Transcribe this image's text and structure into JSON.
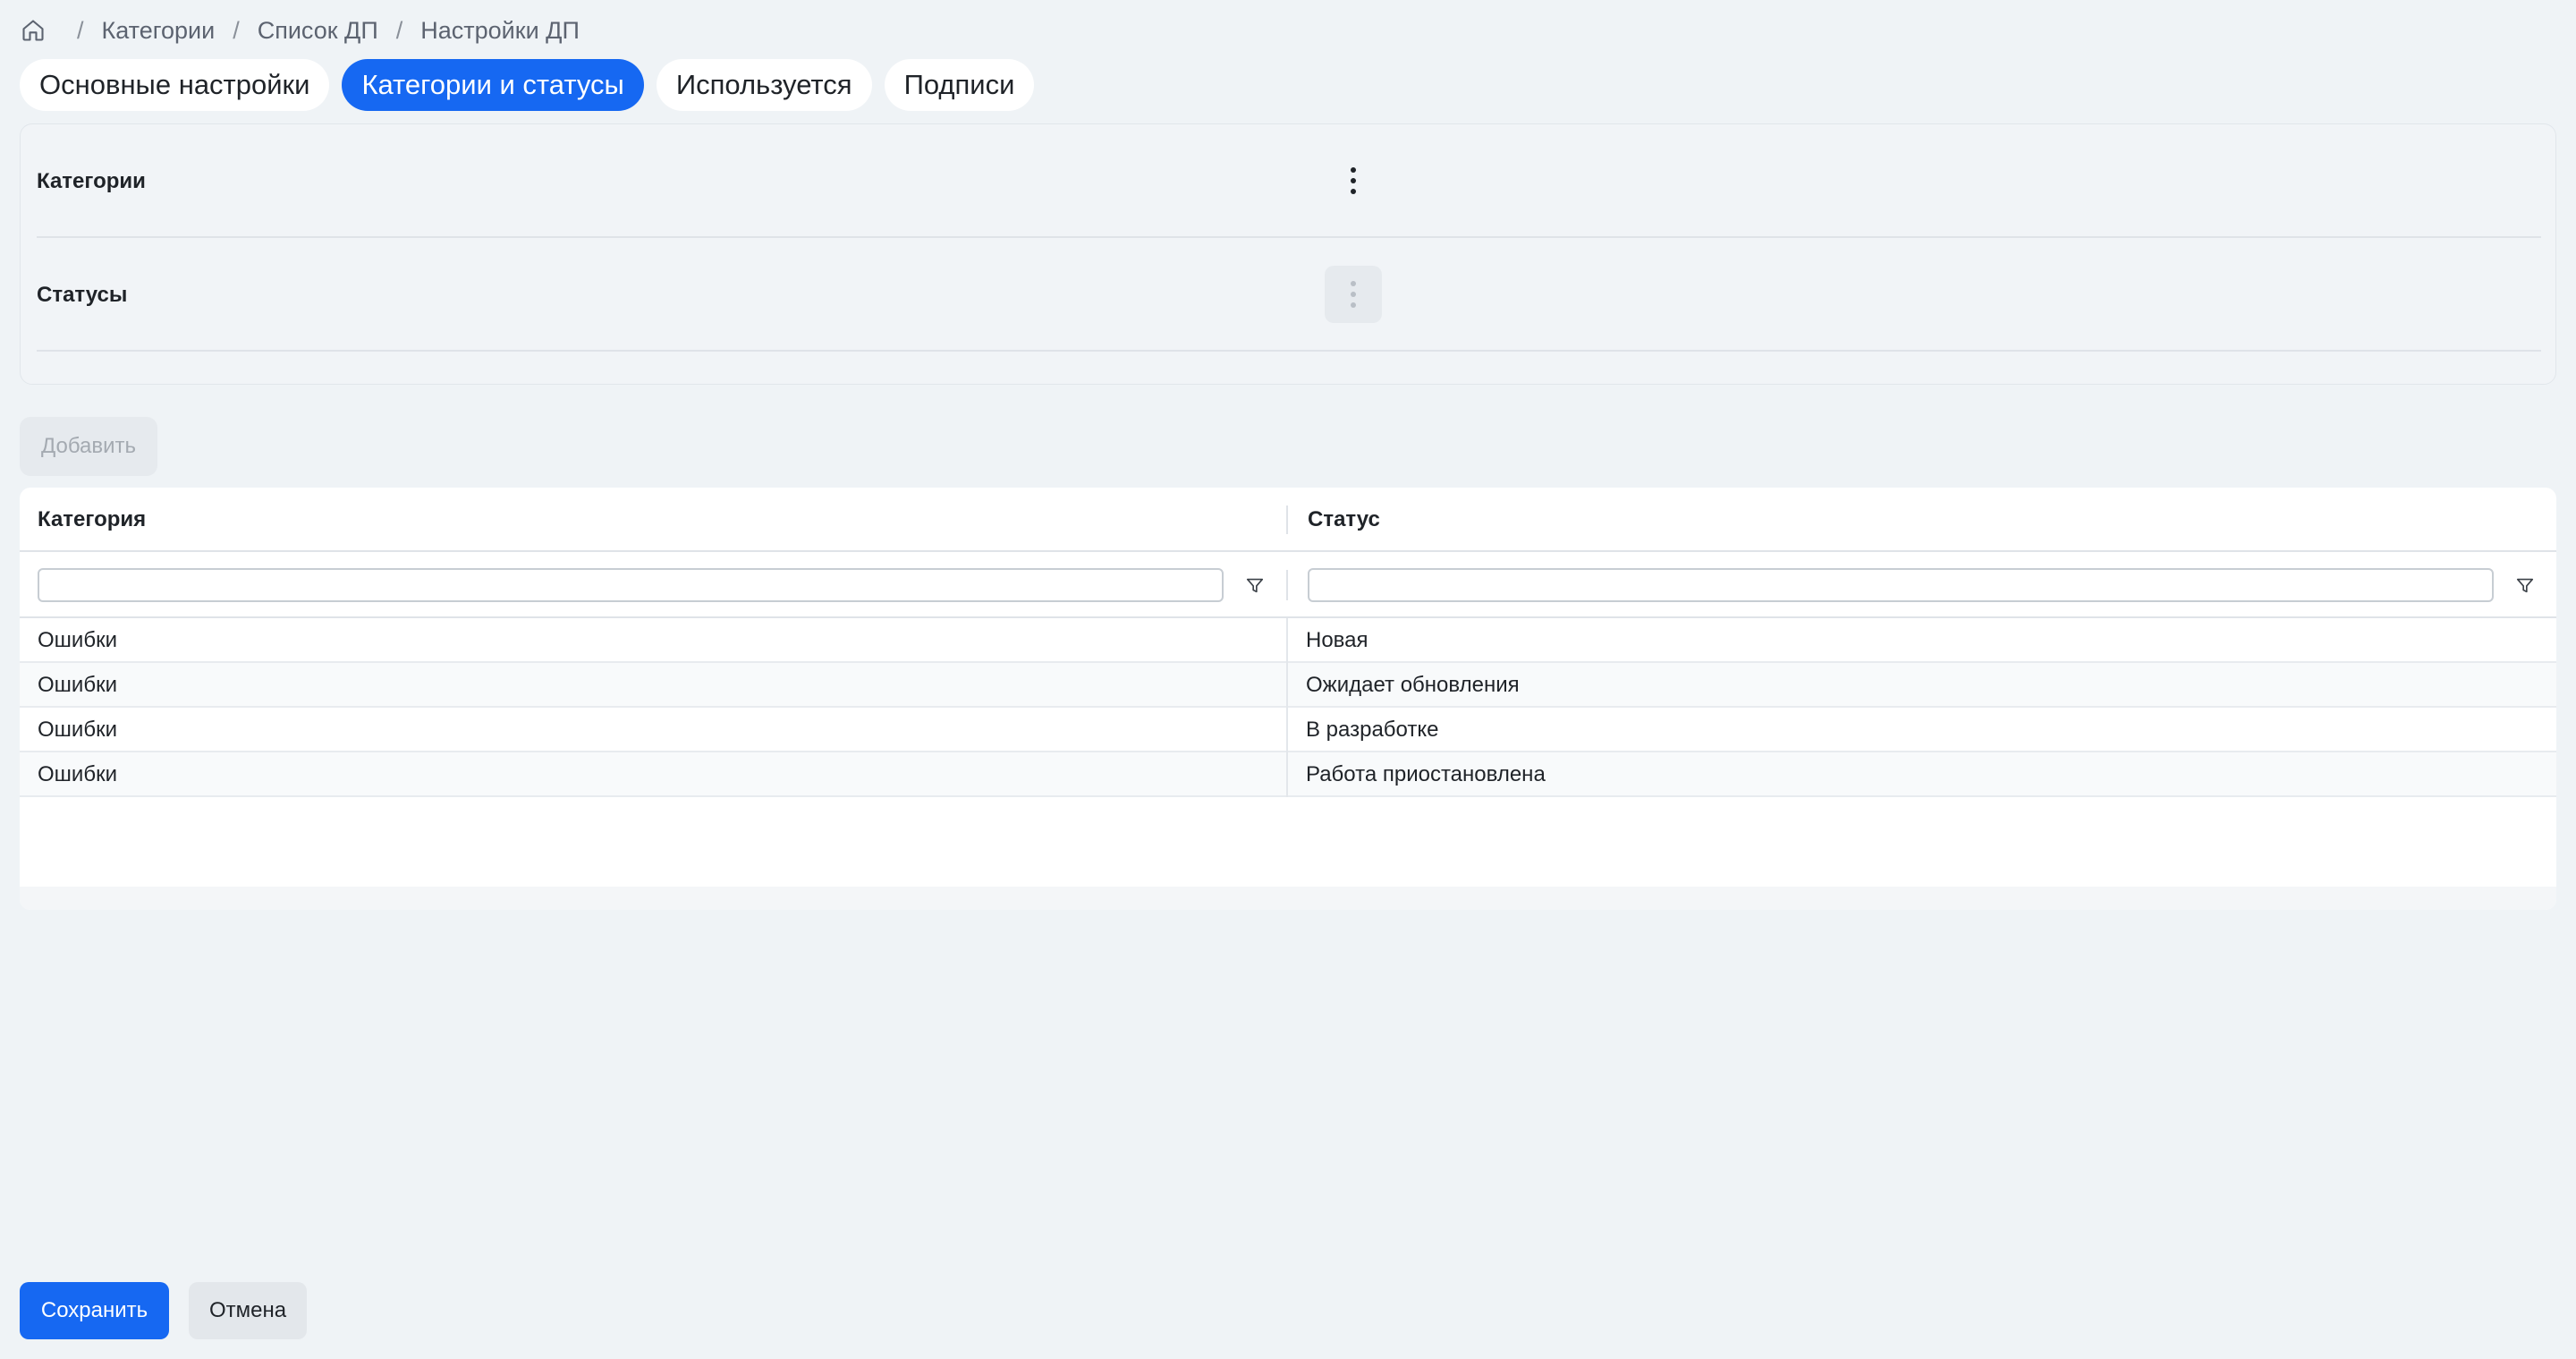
{
  "breadcrumb": {
    "home_icon": "home-icon",
    "items": [
      "Категории",
      "Список ДП",
      "Настройки ДП"
    ],
    "separator": "/"
  },
  "tabs": [
    {
      "label": "Основные настройки",
      "active": false
    },
    {
      "label": "Категории и статусы",
      "active": true
    },
    {
      "label": "Используется",
      "active": false
    },
    {
      "label": "Подписи",
      "active": false
    }
  ],
  "settings": {
    "rows": [
      {
        "label": "Категории",
        "menu_icon": "more-vertical-icon",
        "menu_enabled": true
      },
      {
        "label": "Статусы",
        "menu_icon": "more-vertical-icon",
        "menu_enabled": false
      }
    ]
  },
  "add_button": {
    "label": "Добавить",
    "enabled": false
  },
  "table": {
    "columns": [
      "Категория",
      "Статус"
    ],
    "filters": [
      {
        "value": "",
        "icon": "filter-icon"
      },
      {
        "value": "",
        "icon": "filter-icon"
      }
    ],
    "rows": [
      [
        "Ошибки",
        "Новая"
      ],
      [
        "Ошибки",
        "Ожидает обновления"
      ],
      [
        "Ошибки",
        "В разработке"
      ],
      [
        "Ошибки",
        "Работа приостановлена"
      ]
    ]
  },
  "footer": {
    "save_label": "Сохранить",
    "cancel_label": "Отмена"
  },
  "colors": {
    "accent": "#1668f2",
    "background": "#eff3f6"
  }
}
